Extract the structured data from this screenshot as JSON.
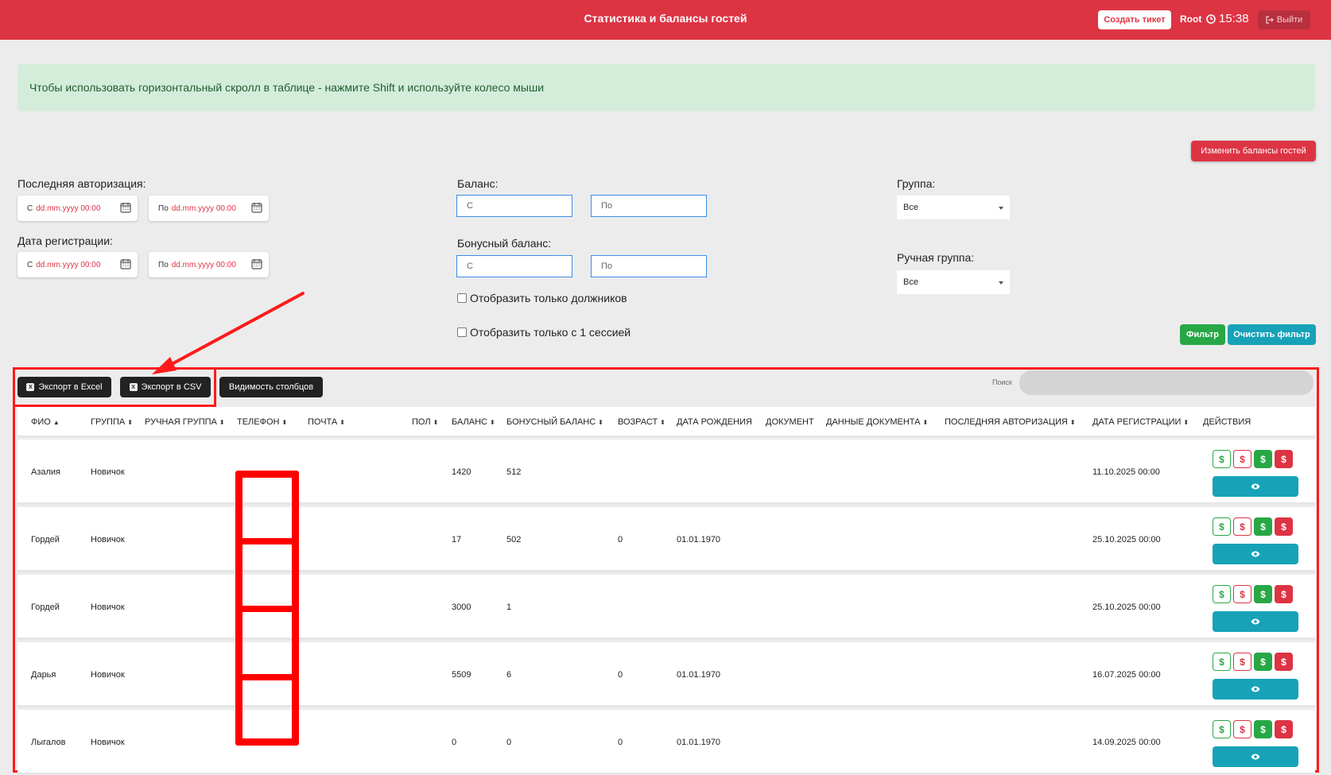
{
  "header": {
    "title": "Статистика и балансы гостей",
    "ticket_btn": "Создать тикет",
    "user": "Root",
    "time": "15:38",
    "logout": "Выйти"
  },
  "alert": "Чтобы использовать горизонтальный скролл в таблице - нажмите Shift и используйте колесо мыши",
  "change_balances_btn": "Изменить балансы гостей",
  "filters": {
    "last_auth_label": "Последняя авторизация:",
    "reg_date_label": "Дата регистрации:",
    "from": "С",
    "to": "По",
    "date_placeholder": "dd.mm.yyyy 00:00",
    "balance_label": "Баланс:",
    "bonus_label": "Бонусный баланс:",
    "num_from": "С",
    "num_to": "По",
    "debtors_only": "Отобразить только должников",
    "one_session_only": "Отобразить только с 1 сессией",
    "group_label": "Группа:",
    "group_value": "Все",
    "manual_group_label": "Ручная группа:",
    "manual_group_value": "Все",
    "filter_btn": "Фильтр",
    "clear_btn": "Очистить фильтр"
  },
  "toolbar": {
    "export_excel": "Экспорт в Excel",
    "export_csv": "Экспорт в CSV",
    "columns": "Видимость столбцов",
    "search_label": "Поиск"
  },
  "table": {
    "headers": [
      "ФИО",
      "ГРУППА",
      "РУЧНАЯ ГРУППА",
      "ТЕЛЕФОН",
      "ПОЧТА",
      "ПОЛ",
      "БАЛАНС",
      "БОНУСНЫЙ БАЛАНС",
      "ВОЗРАСТ",
      "ДАТА РОЖДЕНИЯ",
      "ДОКУМЕНТ",
      "ДАННЫЕ ДОКУМЕНТА",
      "ПОСЛЕДНЯЯ АВТОРИЗАЦИЯ",
      "ДАТА РЕГИСТРАЦИИ",
      "ДЕЙСТВИЯ"
    ],
    "rows": [
      {
        "name": "Азалия",
        "group": "Новичок",
        "balance": "1420",
        "bonus": "512",
        "age": "",
        "birth": "",
        "reg": "11.10.2025 00:00"
      },
      {
        "name": "Гордей",
        "group": "Новичок",
        "balance": "17",
        "bonus": "502",
        "age": "0",
        "birth": "01.01.1970",
        "reg": "25.10.2025 00:00"
      },
      {
        "name": "Гордей",
        "group": "Новичок",
        "balance": "3000",
        "bonus": "1",
        "age": "",
        "birth": "",
        "reg": "25.10.2025 00:00"
      },
      {
        "name": "Дарья",
        "group": "Новичок",
        "balance": "5509",
        "bonus": "6",
        "age": "0",
        "birth": "01.01.1970",
        "reg": "16.07.2025 00:00"
      },
      {
        "name": "Лыгалов",
        "group": "Новичок",
        "balance": "0",
        "bonus": "0",
        "age": "0",
        "birth": "01.01.1970",
        "reg": "14.09.2025 00:00"
      }
    ],
    "action_symbol": "$"
  },
  "colors": {
    "primary_red": "#dd3444",
    "green": "#28a745",
    "teal": "#17a2b8",
    "annotation_red": "#ff1a1a"
  }
}
